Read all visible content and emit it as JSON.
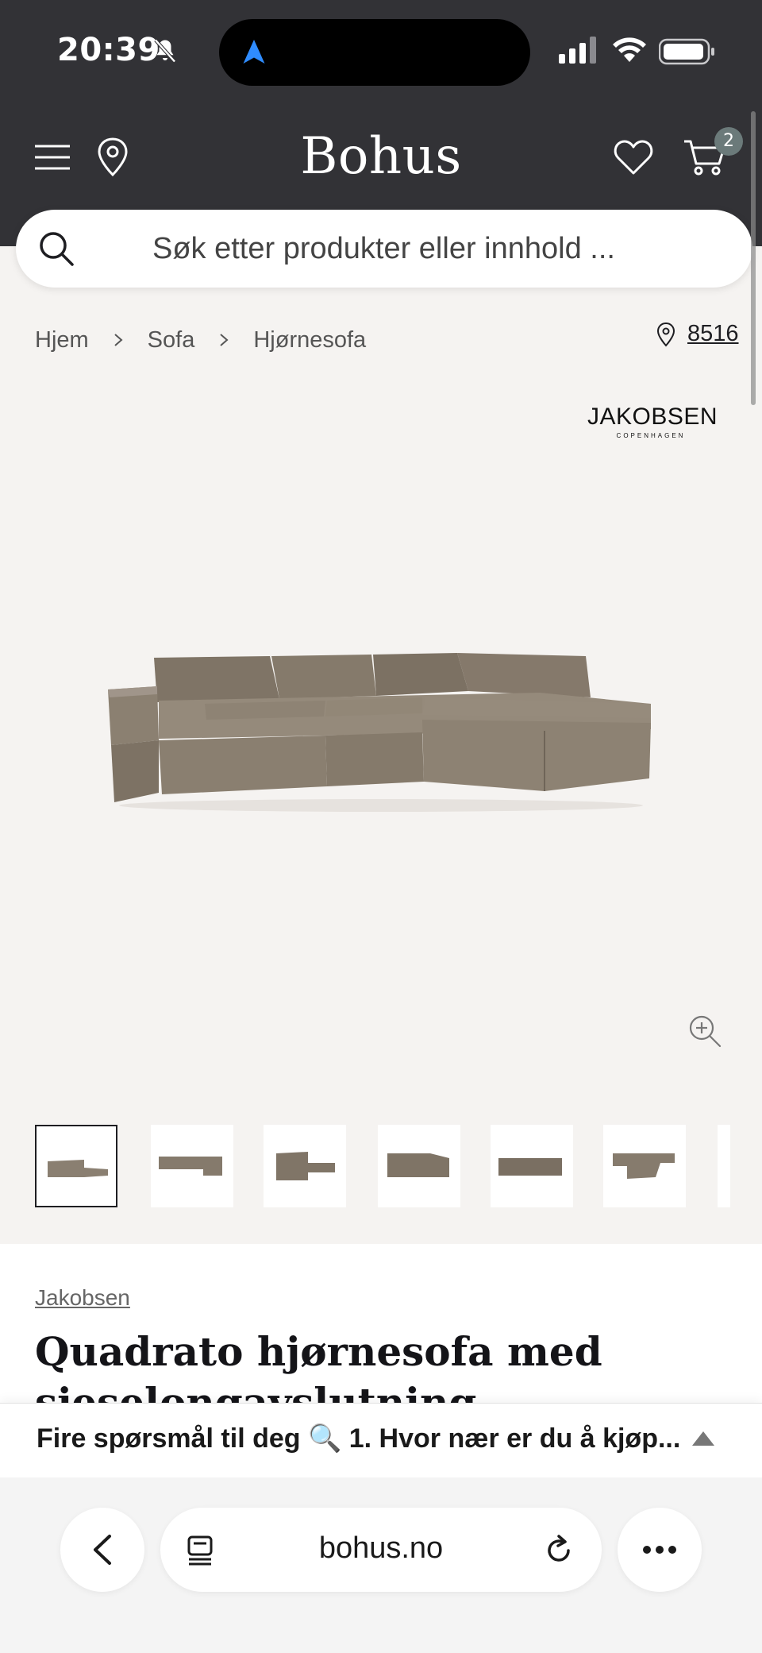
{
  "status_bar": {
    "time": "20:39"
  },
  "header": {
    "logo": "Bohus",
    "cart_count": "2",
    "menu_icon": "hamburger-menu-icon",
    "location_icon": "map-pin-icon",
    "wishlist_icon": "heart-icon",
    "cart_icon": "shopping-cart-icon"
  },
  "search": {
    "placeholder": "Søk etter produkter eller innhold ..."
  },
  "breadcrumb": {
    "items": [
      "Hjem",
      "Sofa",
      "Hjørnesofa"
    ],
    "store_number": "8516"
  },
  "brand_logo": {
    "name": "JAKOBSEN",
    "subtitle": "COPENHAGEN"
  },
  "gallery": {
    "thumbnail_count": 7,
    "active_index": 0
  },
  "product": {
    "brand": "Jakobsen",
    "title": "Quadrato hjørnesofa med ",
    "title_partial": "sjeselongavslutning"
  },
  "promo": {
    "text": "Fire spørsmål til deg 🔍 1. Hvor nær er du å kjøp..."
  },
  "browser": {
    "url": "bohus.no"
  },
  "colors": {
    "header_bg": "#323236",
    "page_bg": "#f5f3f1",
    "sofa": "#8a7f71",
    "cart_badge": "#6b7a7a"
  }
}
